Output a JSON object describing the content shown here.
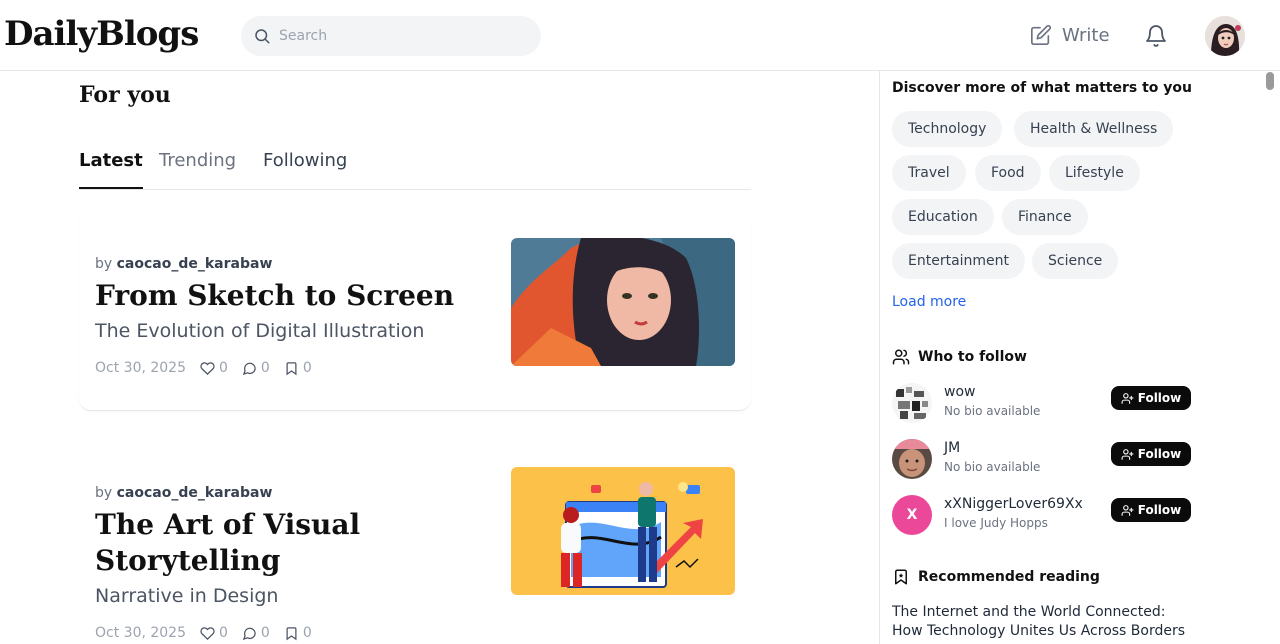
{
  "header": {
    "logo": "DailyBlogs",
    "search_placeholder": "Search",
    "write_label": "Write"
  },
  "main": {
    "heading": "For you",
    "tabs": [
      "Latest",
      "Trending",
      "Following"
    ],
    "active_tab": "Latest",
    "posts": [
      {
        "by_prefix": "by",
        "author": "caocao_de_karabaw",
        "title": "From Sketch to Screen",
        "subtitle": "The Evolution of Digital Illustration",
        "date": "Oct 30, 2025",
        "likes": "0",
        "comments": "0",
        "saves": "0"
      },
      {
        "by_prefix": "by",
        "author": "caocao_de_karabaw",
        "title": "The Art of Visual Storytelling",
        "subtitle": "Narrative in Design",
        "date": "Oct 30, 2025",
        "likes": "0",
        "comments": "0",
        "saves": "0"
      }
    ]
  },
  "sidebar": {
    "discover_heading": "Discover more of what matters to you",
    "topics": [
      "Technology",
      "Health & Wellness",
      "Travel",
      "Food",
      "Lifestyle",
      "Education",
      "Finance",
      "Entertainment",
      "Science"
    ],
    "load_more": "Load more",
    "who_to_follow": "Who to follow",
    "follow_label": "Follow",
    "people": [
      {
        "name": "wow",
        "bio": "No bio available"
      },
      {
        "name": "JM",
        "bio": "No bio available"
      },
      {
        "name": "xXNiggerLover69Xx",
        "bio": "I love Judy Hopps",
        "initial": "X"
      }
    ],
    "recommended_heading": "Recommended reading",
    "recommended_title": "The Internet and the World Connected: How Technology Unites Us Across Borders"
  },
  "colors": {
    "accent_link": "#2563eb",
    "follow_button": "#0b0b0b",
    "chip_bg": "#f3f4f6",
    "pink_avatar": "#ec4899",
    "thumb2_bg": "#fcc148"
  }
}
